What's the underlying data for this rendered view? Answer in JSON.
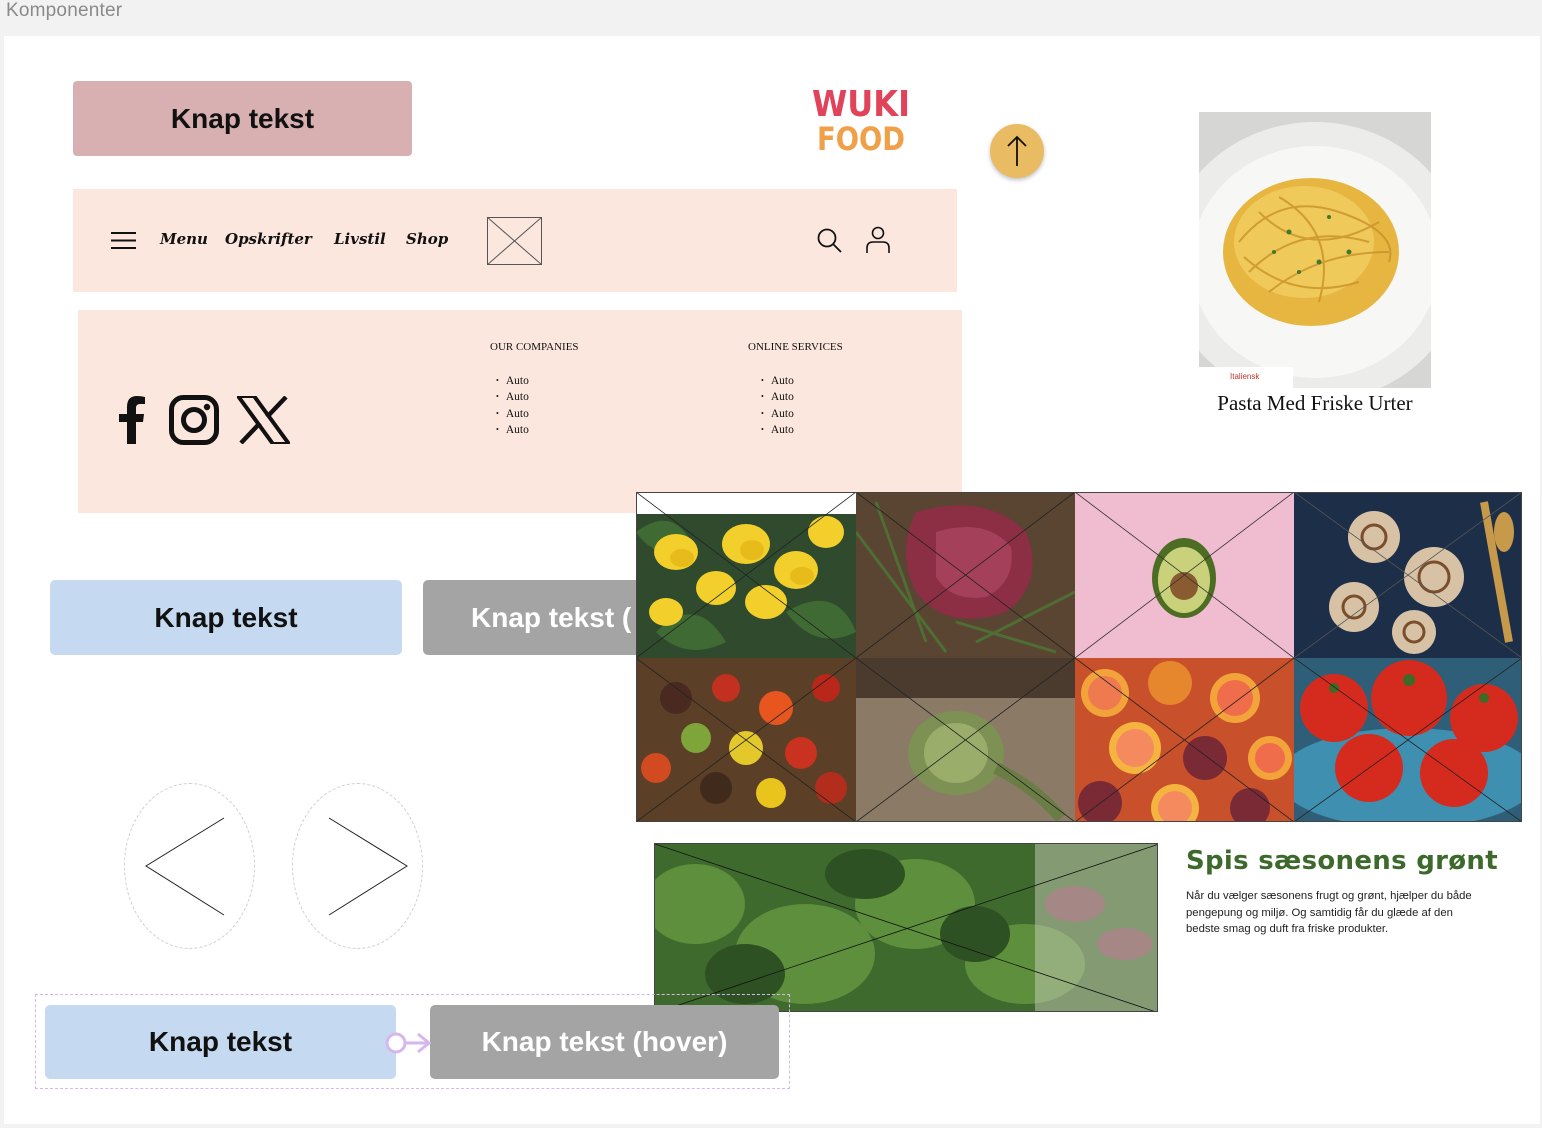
{
  "frame": {
    "label": "Komponenter"
  },
  "buttons": {
    "rose": "Knap tekst",
    "blue_default": "Knap tekst",
    "grey_hover_clipped": "Knap tekst (",
    "blue_default_2": "Knap tekst",
    "grey_hover": "Knap tekst (hover)"
  },
  "logo": {
    "line1": "WUKI",
    "line2": "FOOD"
  },
  "navbar": {
    "links": [
      "Menu",
      "Opskrifter",
      "Livstil",
      "Shop"
    ]
  },
  "footer": {
    "columns": [
      {
        "heading": "OUR COMPANIES",
        "items": [
          "Auto",
          "Auto",
          "Auto",
          "Auto"
        ]
      },
      {
        "heading": "ONLINE SERVICES",
        "items": [
          "Auto",
          "Auto",
          "Auto",
          "Auto"
        ]
      }
    ]
  },
  "recipe_card": {
    "tag": "Italiensk",
    "title": "Pasta Med Friske Urter"
  },
  "seasonal": {
    "heading": "Spis sæsonens grønt",
    "body": "Når du vælger sæsonens frugt og grønt, hjælper du både pengepung og miljø. Og samtidig får du glæde af den bedste smag og duft fra friske produkter."
  },
  "gallery": {
    "tiles": [
      "lemons",
      "raw-meat",
      "avocado",
      "cinnamon-rolls",
      "tomatoes-mixed",
      "artichoke",
      "citrus-pomegranate",
      "red-tomatoes"
    ]
  },
  "colors": {
    "rose_button": "#d9b0b2",
    "blue_button": "#c5daf0",
    "grey_button": "#a4a4a4",
    "nav_bg": "#fbe7dd",
    "scroll_top": "#e9bb63",
    "logo_red": "#e0435a",
    "logo_orange": "#f0a048"
  }
}
